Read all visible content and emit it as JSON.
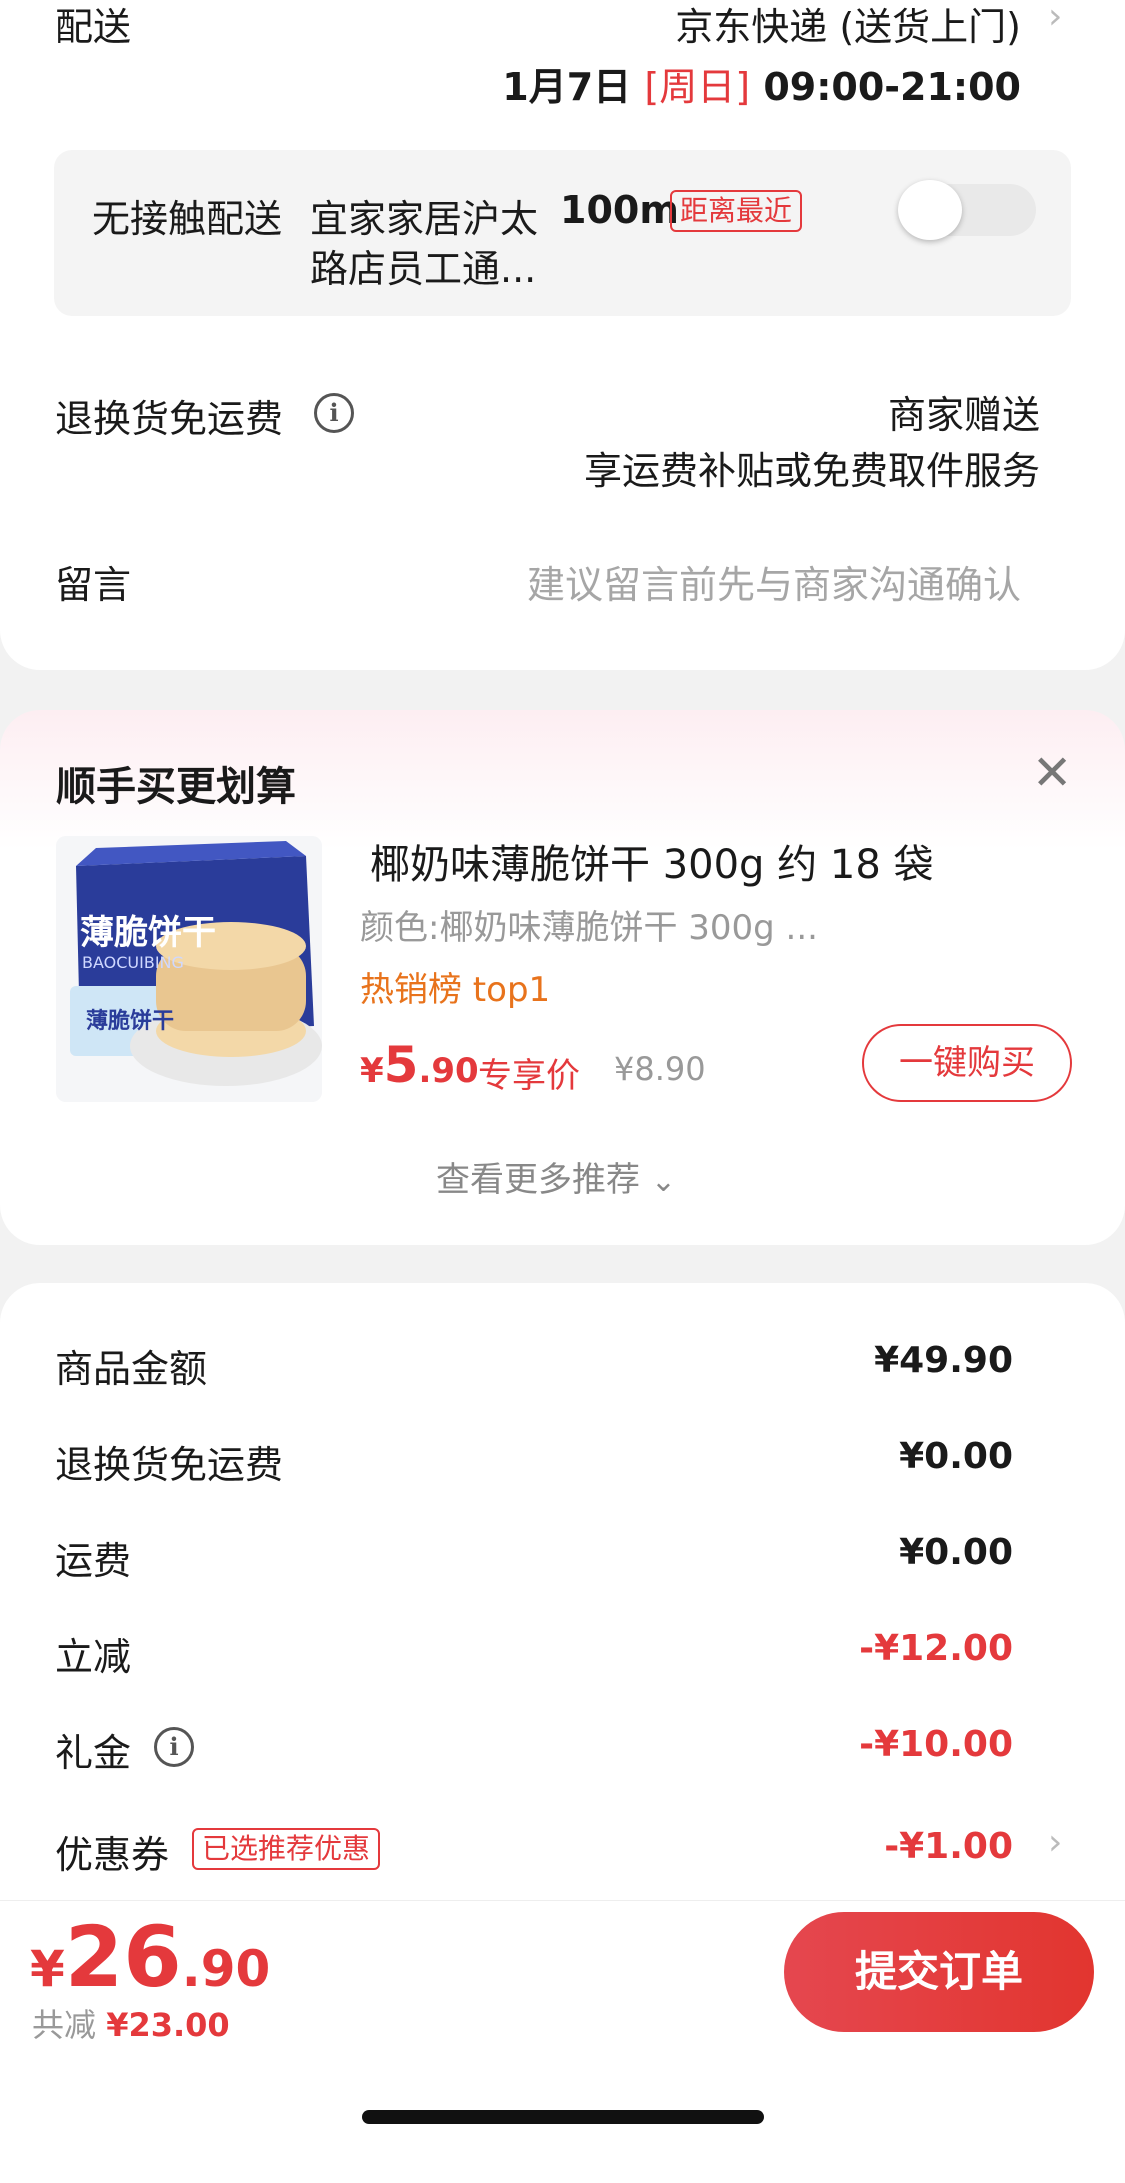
{
  "delivery": {
    "label": "配送",
    "method": "京东快递 (送货上门)",
    "date": "1月7日",
    "weekday": "[周日]",
    "time": "09:00-21:00"
  },
  "contactless": {
    "label": "无接触配送",
    "location_line1": "宜家家居沪太",
    "location_line2": "路店员工通...",
    "distance": "100m",
    "tag": "距离最近",
    "toggle_on": false
  },
  "return_shipping": {
    "label": "退换货免运费",
    "value_line1": "商家赠送",
    "value_line2": "享运费补贴或免费取件服务"
  },
  "message": {
    "label": "留言",
    "placeholder": "建议留言前先与商家沟通确认"
  },
  "recommend": {
    "title": "顺手买更划算",
    "product": {
      "name": "椰奶味薄脆饼干 300g 约 18 袋",
      "spec": "颜色:椰奶味薄脆饼干 300g ...",
      "rank": "热销榜 top1",
      "currency": "¥",
      "price_int": "5",
      "price_dec": ".90",
      "price_label": "专享价",
      "original_price": "¥8.90",
      "buy_label": "一键购买",
      "image_text_main": "薄脆饼干",
      "image_text_sub": "BAOCUIBING",
      "image_text_side": "薄脆饼干"
    },
    "more_label": "查看更多推荐"
  },
  "summary": {
    "rows": [
      {
        "label": "商品金额",
        "value": "¥49.90"
      },
      {
        "label": "退换货免运费",
        "value": "¥0.00"
      },
      {
        "label": "运费",
        "value": "¥0.00"
      },
      {
        "label": "立减",
        "value": "-¥12.00"
      },
      {
        "label": "礼金",
        "value": "-¥10.00"
      },
      {
        "label": "优惠券",
        "value": "-¥1.00",
        "tag": "已选推荐优惠"
      }
    ]
  },
  "footer": {
    "currency": "¥",
    "total_int": "26",
    "total_dec": ".90",
    "saved_label": "共减",
    "saved_value": "¥23.00",
    "submit_label": "提交订单"
  },
  "colors": {
    "accent_red": "#e4393c",
    "rank_orange": "#e8731c",
    "banner_pink": "#fdeef2"
  }
}
